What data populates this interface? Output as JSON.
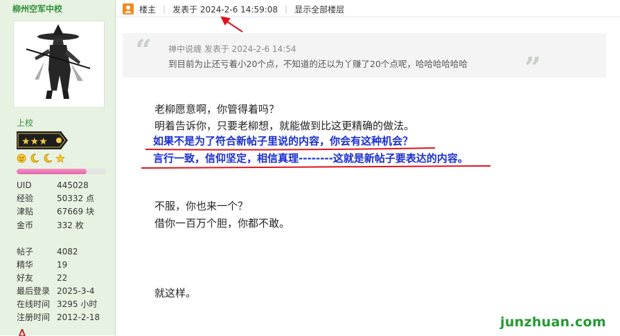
{
  "user": {
    "name": "柳州空军中校",
    "rank": "上校",
    "stats_primary": [
      {
        "label": "UID",
        "value": "445028"
      },
      {
        "label": "经验",
        "value": "50332 点"
      },
      {
        "label": "津贴",
        "value": "67669 块"
      },
      {
        "label": "金币",
        "value": "332 枚"
      }
    ],
    "stats_secondary": [
      {
        "label": "帖子",
        "value": "4082"
      },
      {
        "label": "精华",
        "value": "19"
      },
      {
        "label": "好友",
        "value": "22"
      }
    ],
    "stats_dates": [
      {
        "label": "最后登录",
        "value": "2025-3-4"
      },
      {
        "label": "在线时间",
        "value": "3295 小时"
      },
      {
        "label": "注册时间",
        "value": "2012-2-18"
      }
    ],
    "level_progress": 0.78
  },
  "post_header": {
    "floor": "楼主",
    "posted_at": "发表于 2024-2-6 14:59:08",
    "show_all": "显示全部楼层"
  },
  "quote": {
    "author": "禅中说缠 发表于 2024-2-6 14:54",
    "text": "到目前为止还亏着小20个点，不知道的还以为丫赚了20个点呢，哈哈哈哈哈哈"
  },
  "body": {
    "line_1": "老柳愿意啊，你管得着吗？",
    "line_2": "明着告诉你，只要老柳想，就能做到比这更精确的做法。",
    "line_3": "如果不是为了符合新帖子里说的内容，你会有这种机会？",
    "line_4": "言行一致，信仰坚定，相信真理--------这就是新帖子要表达的内容。",
    "line_5": "不服，你也来一个？",
    "line_6": "借你一百万个胆，你都不敢。",
    "line_7": "就这样。"
  },
  "watermark": "junzhuan.com",
  "icons": {
    "owner": "owner-icon",
    "avatar": "avatar-image",
    "rank_badge": "rank-badge-icon",
    "medals": [
      "sun-medal-icon",
      "moon-medal-icon",
      "moon-medal-icon",
      "star-medal-icon"
    ]
  },
  "colors": {
    "sidebar_bg": "#e8f2e2",
    "username": "#2f8f3a",
    "highlight_text": "#1a2fd0",
    "underline": "#e0101a",
    "arrow": "#e0101a",
    "watermark": "#219a2e"
  }
}
